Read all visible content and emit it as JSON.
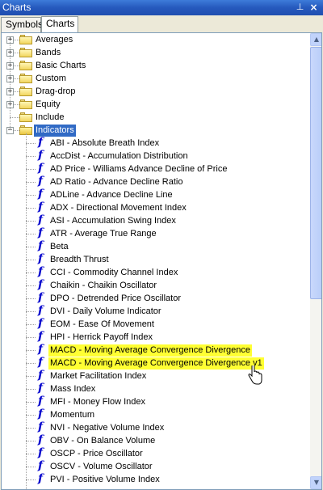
{
  "window": {
    "title": "Charts",
    "pin_icon": "pin-icon",
    "close_icon": "close-icon"
  },
  "tabs": [
    {
      "label": "Symbols"
    },
    {
      "label": "Charts",
      "active": true
    }
  ],
  "folders": [
    {
      "label": "Averages",
      "expanded": false
    },
    {
      "label": "Bands",
      "expanded": false
    },
    {
      "label": "Basic Charts",
      "expanded": false
    },
    {
      "label": "Custom",
      "expanded": false
    },
    {
      "label": "Drag-drop",
      "expanded": false
    },
    {
      "label": "Equity",
      "expanded": false
    },
    {
      "label": "Include",
      "expanded": false
    },
    {
      "label": "Indicators",
      "expanded": true,
      "selected": true
    }
  ],
  "indicators": [
    "ABI - Absolute Breath Index",
    "AccDist - Accumulation Distribution",
    "AD Price - Williams Advance Decline of Price",
    "AD Ratio - Advance Decline Ratio",
    "ADLine - Advance Decline Line",
    "ADX - Directional Movement Index",
    "ASI - Accumulation Swing Index",
    "ATR - Average True Range",
    "Beta",
    "Breadth Thrust",
    "CCI - Commodity Channel Index",
    "Chaikin - Chaikin Oscillator",
    "DPO - Detrended Price Oscillator",
    "DVI - Daily Volume Indicator",
    "EOM - Ease Of Movement",
    "HPI - Herrick Payoff Index",
    "MACD - Moving Average Convergence Divergence",
    "MACD - Moving Average Convergence Divergence v1",
    "Market Facilitation Index",
    "Mass Index",
    "MFI - Money Flow Index",
    "Momentum",
    "NVI - Negative Volume Index",
    "OBV - On Balance Volume",
    "OSCP - Price Oscillator",
    "OSCV - Volume Oscillator",
    "PVI - Positive Volume Index"
  ],
  "highlighted_indicators": [
    16,
    17
  ],
  "colors": {
    "selection": "#316ac5",
    "highlight": "#ffff33",
    "function_icon": "#0000cc"
  }
}
